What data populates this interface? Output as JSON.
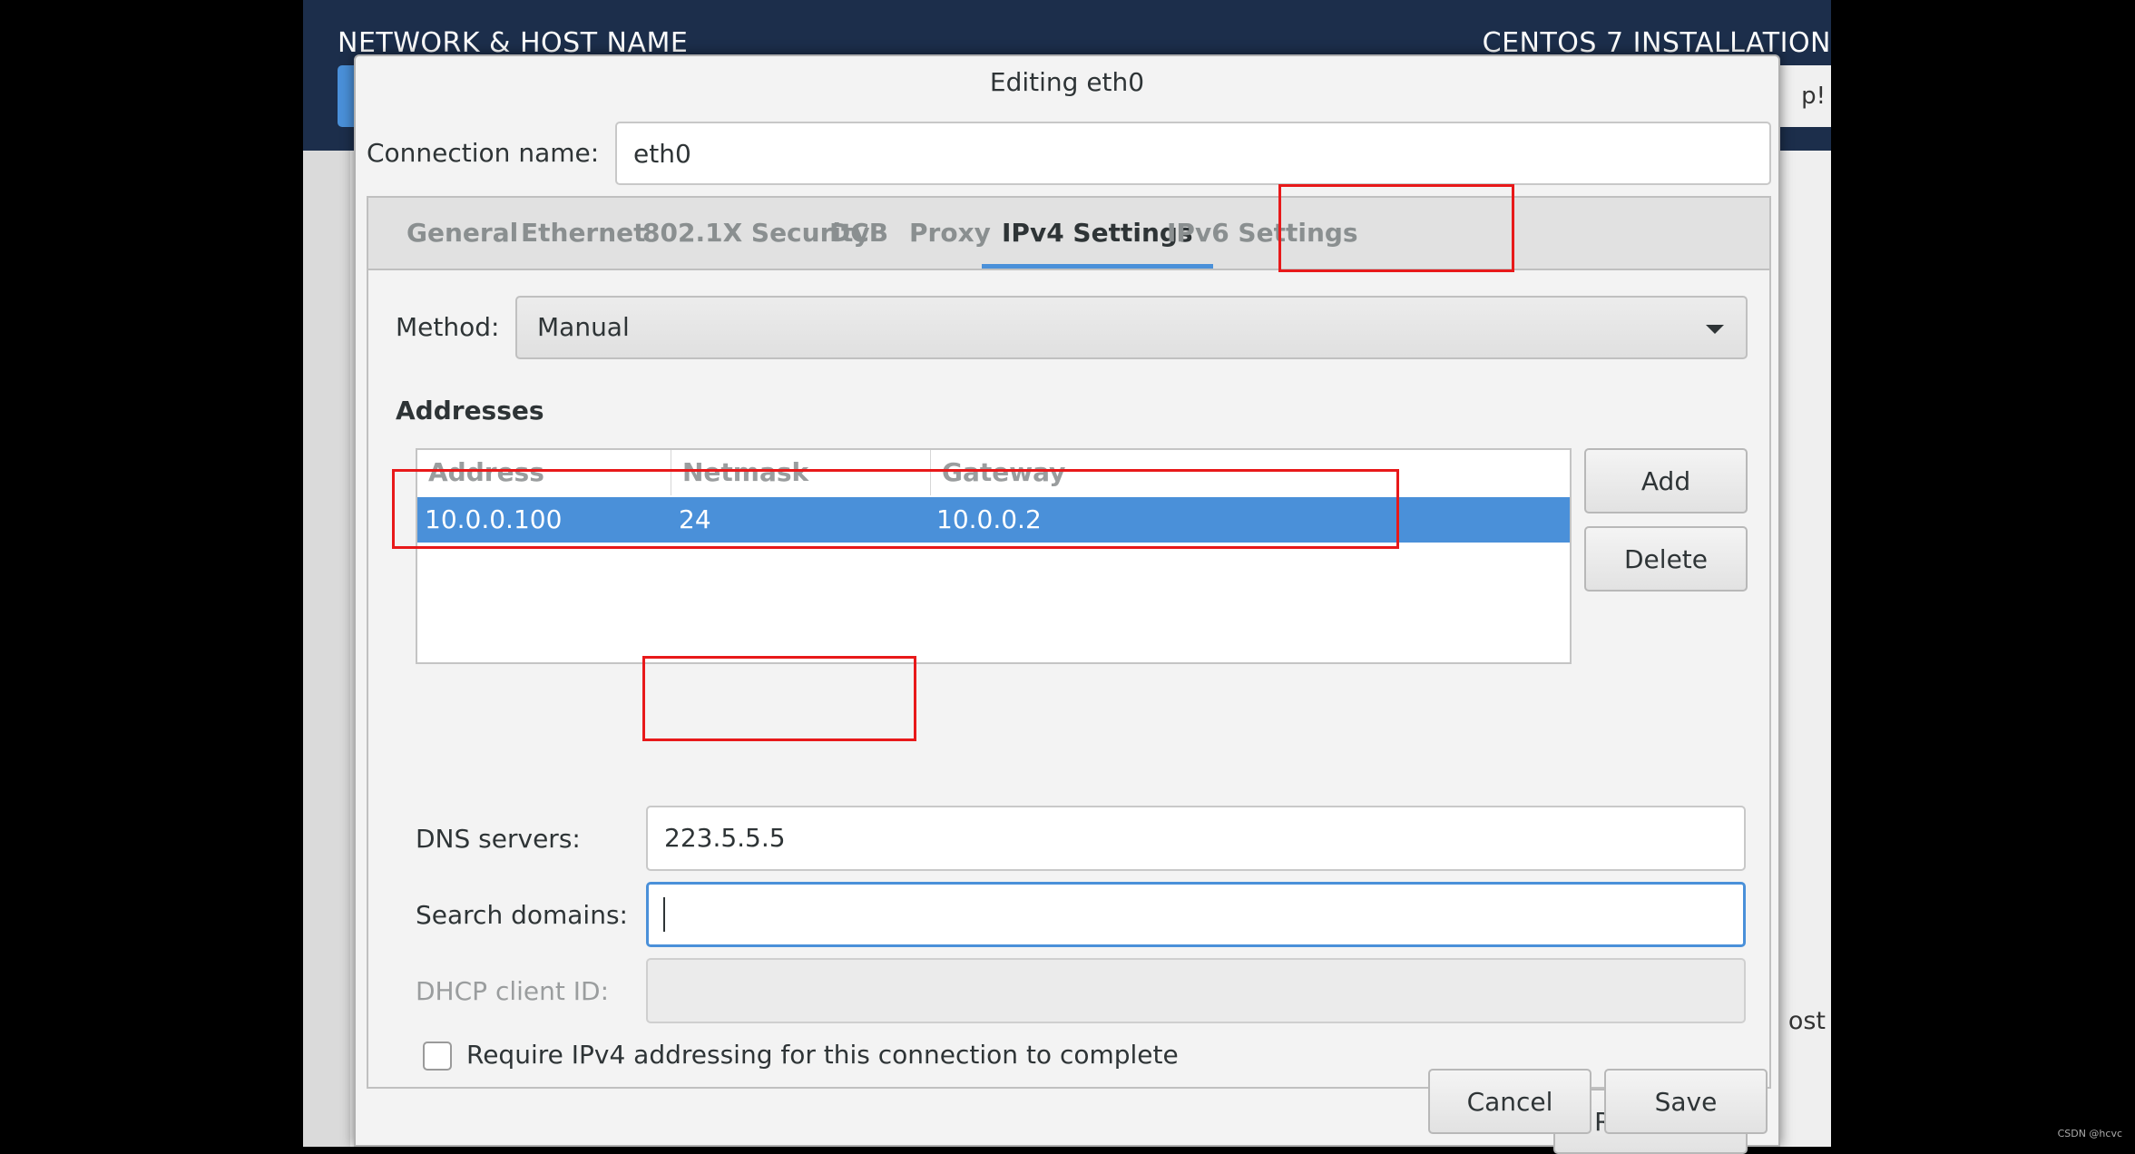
{
  "background": {
    "title": "NETWORK & HOST NAME",
    "product": "CENTOS 7 INSTALLATION",
    "help_fragment": "p!",
    "host_fragment": "ost"
  },
  "dialog": {
    "title": "Editing eth0",
    "connection_name_label": "Connection name:",
    "connection_name_value": "eth0",
    "tabs": [
      {
        "label": "General"
      },
      {
        "label": "Ethernet"
      },
      {
        "label": "802.1X Security"
      },
      {
        "label": "DCB"
      },
      {
        "label": "Proxy"
      },
      {
        "label": "IPv4 Settings",
        "active": true
      },
      {
        "label": "IPv6 Settings"
      }
    ],
    "method_label": "Method:",
    "method_value": "Manual",
    "addresses_heading": "Addresses",
    "table": {
      "columns": [
        "Address",
        "Netmask",
        "Gateway"
      ],
      "rows": [
        {
          "address": "10.0.0.100",
          "netmask": "24",
          "gateway": "10.0.0.2",
          "selected": true
        }
      ]
    },
    "add_label": "Add",
    "delete_label": "Delete",
    "dns_label": "DNS servers:",
    "dns_value": "223.5.5.5",
    "search_label": "Search domains:",
    "search_value": "",
    "dhcp_label": "DHCP client ID:",
    "dhcp_value": "",
    "require_label": "Require IPv4 addressing for this connection to complete",
    "require_checked": false,
    "routes_label": "Routes…",
    "cancel_label": "Cancel",
    "save_label": "Save"
  },
  "colors": {
    "selection": "#4a90d9",
    "header_bg": "#1c2e4b",
    "highlight": "#e8191a"
  },
  "watermark": "CSDN @hcvc"
}
